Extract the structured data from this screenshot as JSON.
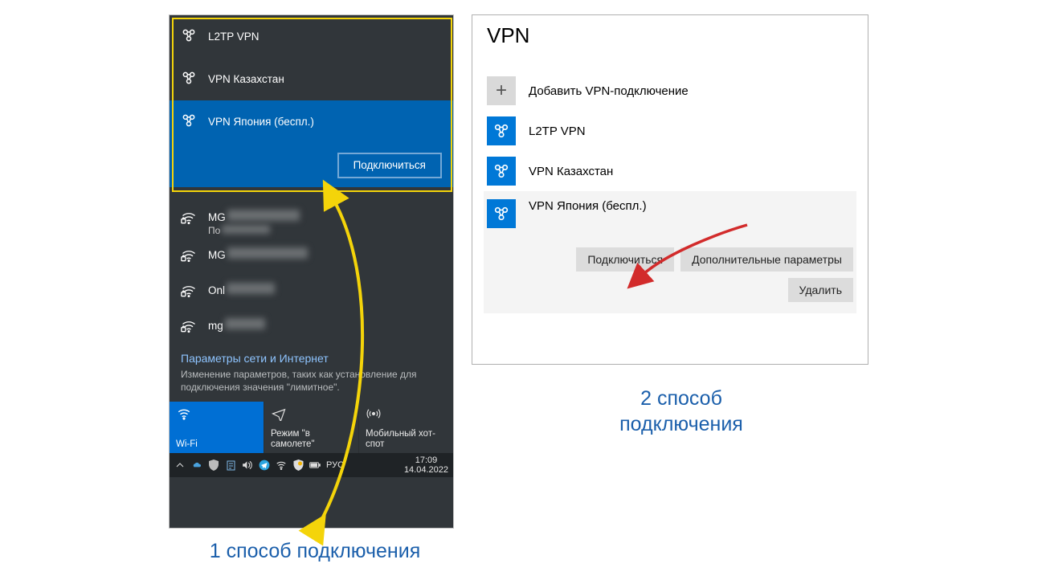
{
  "flyout": {
    "vpn_items": [
      {
        "label": "L2TP VPN",
        "selected": false
      },
      {
        "label": "VPN Казахстан",
        "selected": false
      },
      {
        "label": "VPN Япония (беспл.)",
        "selected": true
      }
    ],
    "connect_button": "Подключиться",
    "wifi_items": [
      {
        "name": "MG",
        "sub": "По"
      },
      {
        "name": "MG",
        "sub": ""
      },
      {
        "name": "Onl",
        "sub": ""
      },
      {
        "name": "mg",
        "sub": ""
      }
    ],
    "settings_link": "Параметры сети и Интернет",
    "settings_desc": "Изменение параметров, таких как установление для подключения значения \"лимитное\".",
    "tiles": [
      {
        "label": "Wi-Fi",
        "active": true
      },
      {
        "label": "Режим \"в самолете\"",
        "active": false
      },
      {
        "label": "Мобильный хот-спот",
        "active": false
      }
    ],
    "taskbar": {
      "lang": "РУС",
      "time": "17:09",
      "date": "14.04.2022"
    }
  },
  "settings": {
    "title": "VPN",
    "add_label": "Добавить VPN-подключение",
    "items": [
      {
        "label": "L2TP VPN",
        "selected": false
      },
      {
        "label": "VPN Казахстан",
        "selected": false
      },
      {
        "label": "VPN Япония (беспл.)",
        "selected": true
      }
    ],
    "buttons": {
      "connect": "Подключиться",
      "advanced": "Дополнительные параметры",
      "delete": "Удалить"
    }
  },
  "captions": {
    "c1": "1 способ подключения",
    "c2": "2 способ подключения"
  }
}
